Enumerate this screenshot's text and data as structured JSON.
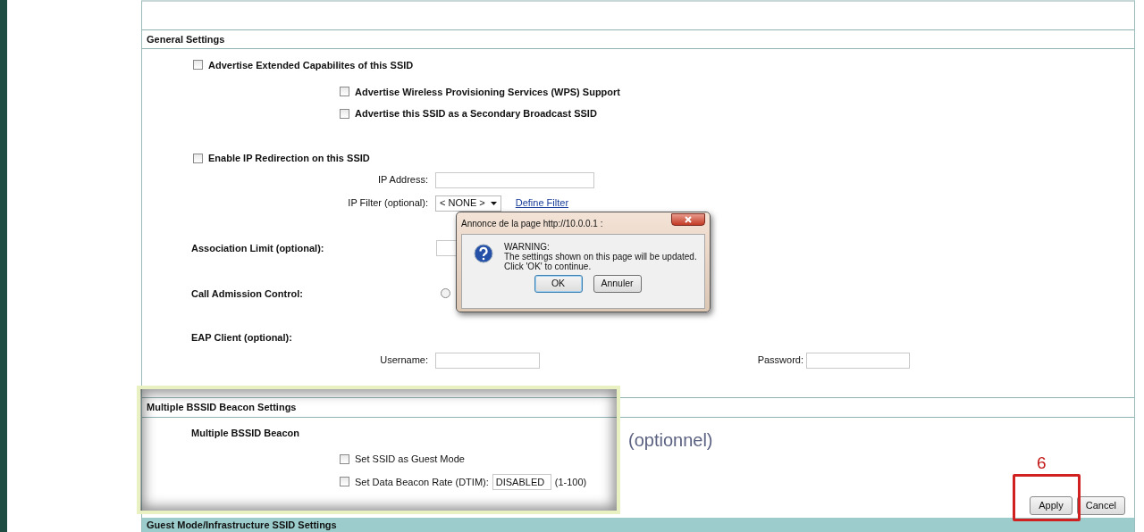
{
  "general": {
    "title": "General Settings",
    "checkboxes": [
      {
        "label": "Advertise Extended Capabilites of this SSID",
        "checked": false,
        "children": [
          {
            "label": "Advertise Wireless Provisioning Services (WPS) Support",
            "checked": false
          },
          {
            "label": "Advertise this SSID as a Secondary Broadcast SSID",
            "checked": false
          }
        ]
      }
    ],
    "redirection": {
      "label": "Enable IP Redirection on this SSID",
      "checked": false,
      "ip_address": {
        "label": "IP Address:"
      },
      "ip_filter": {
        "label": "IP Filter (optional):",
        "value": "< NONE >",
        "link": "Define Filter"
      }
    },
    "association_limit": {
      "label": "Association Limit (optional):"
    },
    "call_admission": {
      "label": "Call Admission Control:",
      "selected": false
    },
    "eap_client": {
      "label": "EAP Client (optional):",
      "username": {
        "label": "Username:"
      },
      "password": {
        "label": "Password:"
      }
    }
  },
  "beacon": {
    "title": "Multiple BSSID Beacon Settings",
    "label": "Multiple BSSID Beacon",
    "options": [
      {
        "label": "Set SSID as Guest Mode",
        "checked": false
      },
      {
        "label": "Set Data Beacon Rate (DTIM):",
        "checked": false,
        "value": "DISABLED",
        "range": "(1-100)"
      }
    ]
  },
  "buttons": [
    {
      "label": "Apply"
    },
    {
      "label": "Cancel"
    }
  ],
  "next_section": {
    "title": "Guest Mode/Infrastructure SSID Settings"
  },
  "annotations": {
    "note": "(optionnel)",
    "step": "6"
  },
  "dialog": {
    "title": "Annonce de la page http://10.0.0.1 :",
    "lines": [
      "WARNING:",
      "The settings shown on this page will be updated.",
      "Click 'OK' to continue."
    ],
    "buttons": [
      {
        "label": "OK",
        "focused": true
      },
      {
        "label": "Annuler",
        "focused": false
      }
    ]
  }
}
